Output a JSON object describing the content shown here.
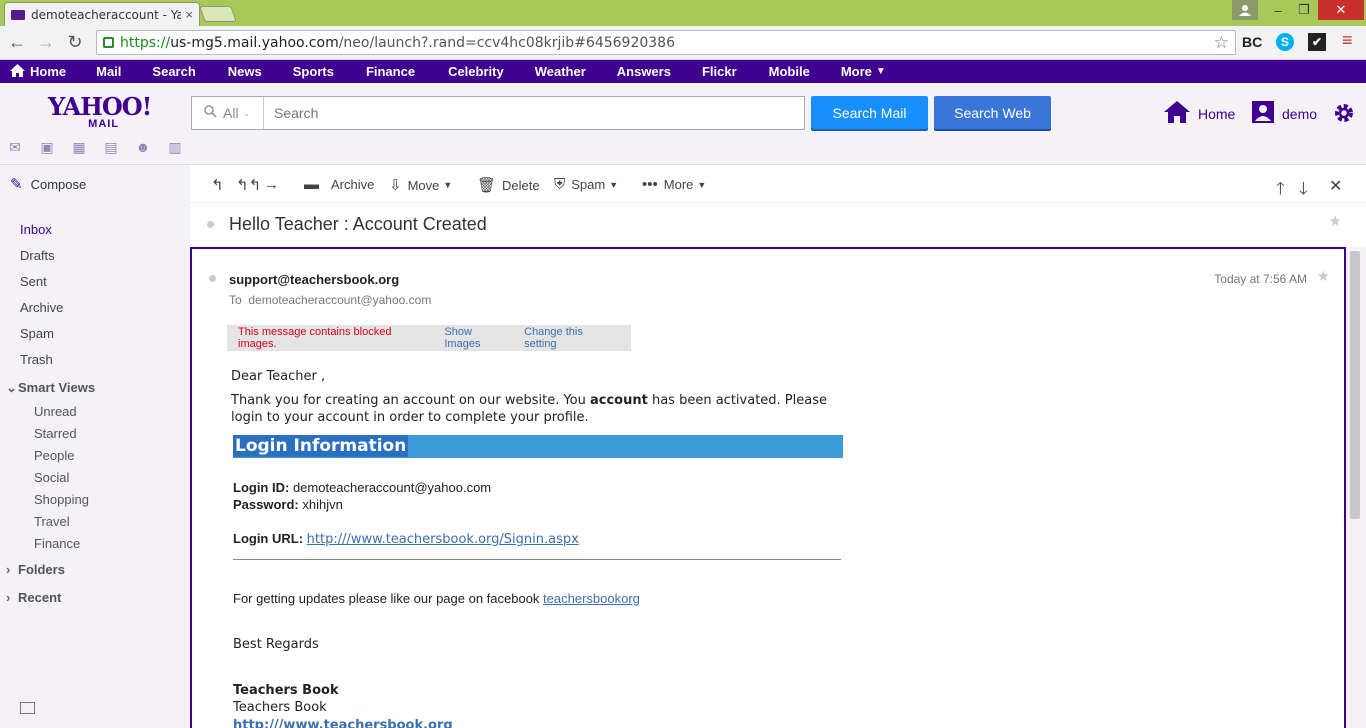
{
  "browser": {
    "tab_title": "demoteacheraccount - Yal",
    "tab_close": "×",
    "url_https": "https://",
    "url_host": "us-mg5.mail.yahoo.com",
    "url_path": "/neo/launch?.rand=ccv4hc08krjib#6456920386",
    "ext_bc": "BC",
    "ext_skype": "S",
    "ext_check": "✔",
    "win_min": "–",
    "win_max": "❐",
    "win_close": "✕"
  },
  "yahoo_nav": {
    "items": [
      "Home",
      "Mail",
      "Search",
      "News",
      "Sports",
      "Finance",
      "Celebrity",
      "Weather",
      "Answers",
      "Flickr",
      "Mobile",
      "More"
    ]
  },
  "header": {
    "logo_line1": "YAHOO!",
    "logo_line2": "MAIL",
    "search_scope": "All",
    "search_placeholder": "Search",
    "search_mail_label": "Search Mail",
    "search_web_label": "Search Web",
    "home_label": "Home",
    "user_label": "demo"
  },
  "sidebar": {
    "compose_label": "Compose",
    "folders": [
      "Inbox",
      "Drafts",
      "Sent",
      "Archive",
      "Spam",
      "Trash"
    ],
    "smart_views_label": "Smart Views",
    "smart_views": [
      "Unread",
      "Starred",
      "People",
      "Social",
      "Shopping",
      "Travel",
      "Finance"
    ],
    "folders_label": "Folders",
    "recent_label": "Recent"
  },
  "toolbar": {
    "archive": "Archive",
    "move": "Move",
    "delete": "Delete",
    "spam": "Spam",
    "more": "More"
  },
  "message": {
    "subject": "Hello Teacher : Account Created",
    "sender": "support@teachersbook.org",
    "to_prefix": "To",
    "to_address": "demoteacheraccount@yahoo.com",
    "timestamp": "Today at 7:56 AM",
    "blocked_notice": "This message contains blocked images.",
    "show_images": "Show Images",
    "change_setting": "Change this setting"
  },
  "email_body": {
    "greeting": "Dear Teacher ,",
    "para_before": "Thank you for creating an account on our website. You ",
    "para_bold": "account",
    "para_after": " has been activated. Please login to your account in order to complete your profile.",
    "banner": "Login Information",
    "login_id_label": "Login ID:",
    "login_id_value": " demoteacheraccount@yahoo.com",
    "password_label": "Password:",
    "password_value": " xhihjvn",
    "login_url_label": "Login URL:",
    "login_url_value": "http:///www.teachersbook.org/Signin.aspx",
    "facebook_text": "For getting updates please like our page on facebook ",
    "facebook_link": "teachersbookorg",
    "regards": "Best Regards",
    "sig_name_bold": "Teachers Book",
    "sig_name": "Teachers Book",
    "sig_url": "http:///www.teachersbook.org"
  }
}
